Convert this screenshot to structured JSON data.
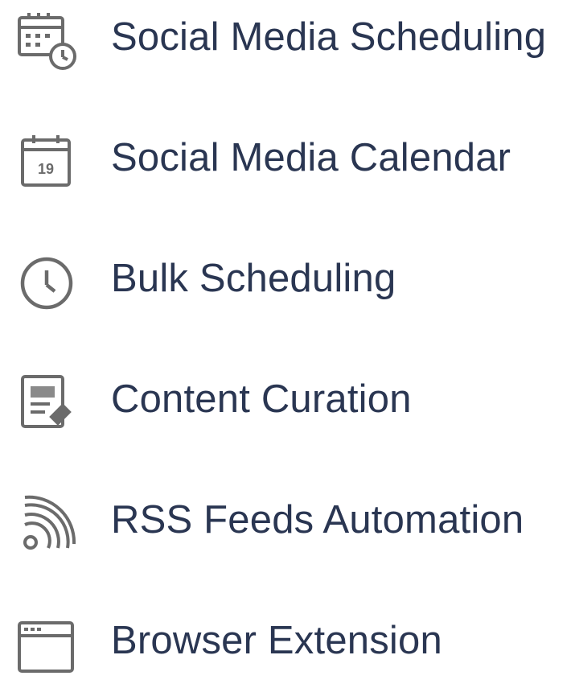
{
  "menu": {
    "items": [
      {
        "label": "Social Media Scheduling",
        "icon": "calendar-clock-icon"
      },
      {
        "label": "Social Media Calendar",
        "icon": "calendar-icon",
        "icon_text": "19"
      },
      {
        "label": "Bulk Scheduling",
        "icon": "clock-icon"
      },
      {
        "label": "Content Curation",
        "icon": "document-edit-icon"
      },
      {
        "label": "RSS Feeds Automation",
        "icon": "rss-icon"
      },
      {
        "label": "Browser Extension",
        "icon": "browser-window-icon"
      }
    ]
  },
  "colors": {
    "label_text": "#2a3652",
    "icon_stroke": "#6b6b6b"
  }
}
